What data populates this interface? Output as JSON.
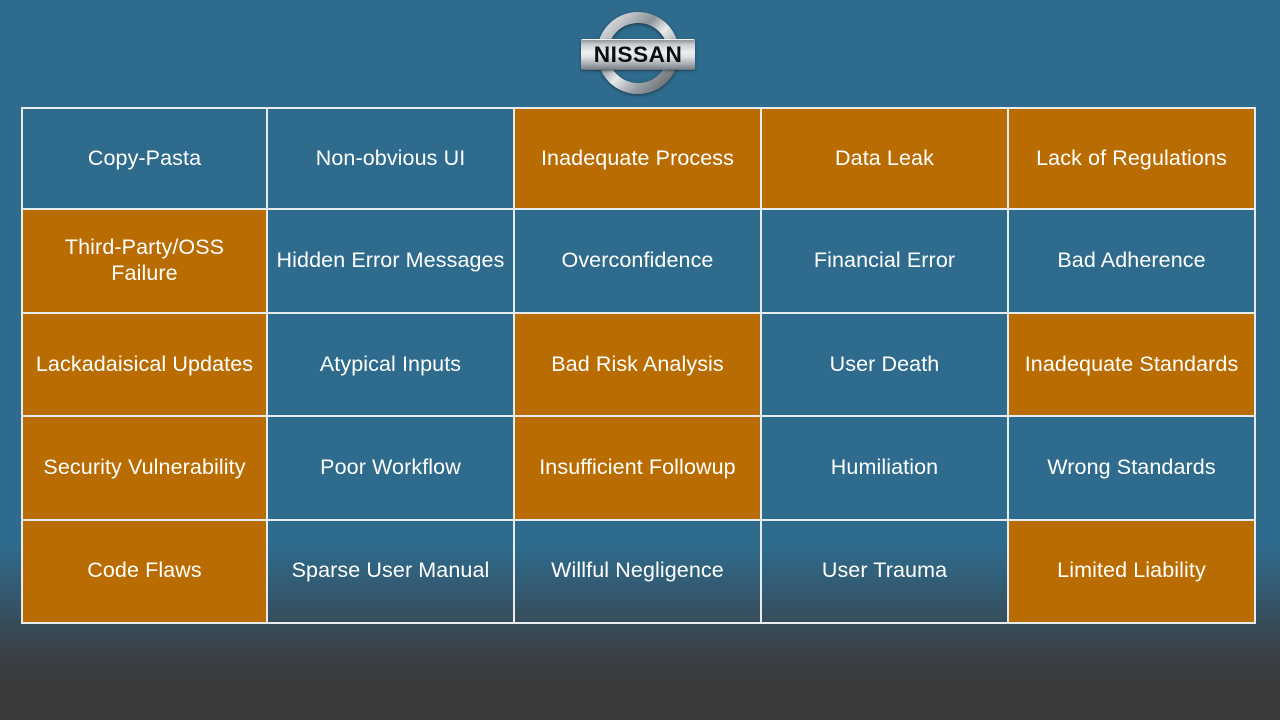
{
  "slide": {
    "background_top_color": "#2E6B8C",
    "background_bottom_color": "#393A3B",
    "cell_orange_color": "#B96C01",
    "cell_blue_color": "#2E6B8C",
    "border_color": "#E9ECEF",
    "text_color": "#FFFFFF"
  },
  "logo": {
    "name": "nissan-logo",
    "wordmark": "NISSAN"
  },
  "matrix": {
    "columns": 5,
    "rows": 5,
    "cells": [
      [
        {
          "label": "Copy-Pasta",
          "fill": "blue"
        },
        {
          "label": "Non-obvious UI",
          "fill": "blue"
        },
        {
          "label": "Inadequate Process",
          "fill": "orange"
        },
        {
          "label": "Data Leak",
          "fill": "orange"
        },
        {
          "label": "Lack of Regulations",
          "fill": "orange"
        }
      ],
      [
        {
          "label": "Third-Party/OSS Failure",
          "fill": "orange"
        },
        {
          "label": "Hidden Error Messages",
          "fill": "blue"
        },
        {
          "label": "Overconfidence",
          "fill": "blue"
        },
        {
          "label": "Financial Error",
          "fill": "blue"
        },
        {
          "label": "Bad Adherence",
          "fill": "blue"
        }
      ],
      [
        {
          "label": "Lackadaisical Updates",
          "fill": "orange"
        },
        {
          "label": "Atypical Inputs",
          "fill": "blue"
        },
        {
          "label": "Bad Risk Analysis",
          "fill": "orange"
        },
        {
          "label": "User Death",
          "fill": "blue"
        },
        {
          "label": "Inadequate Standards",
          "fill": "orange"
        }
      ],
      [
        {
          "label": "Security Vulnerability",
          "fill": "orange"
        },
        {
          "label": "Poor Workflow",
          "fill": "blue"
        },
        {
          "label": "Insufficient Followup",
          "fill": "orange"
        },
        {
          "label": "Humiliation",
          "fill": "blue"
        },
        {
          "label": "Wrong Standards",
          "fill": "blue"
        }
      ],
      [
        {
          "label": "Code Flaws",
          "fill": "orange"
        },
        {
          "label": "Sparse User Manual",
          "fill": "blue"
        },
        {
          "label": "Willful Negligence",
          "fill": "blue"
        },
        {
          "label": "User Trauma",
          "fill": "blue"
        },
        {
          "label": "Limited Liability",
          "fill": "orange"
        }
      ]
    ]
  }
}
